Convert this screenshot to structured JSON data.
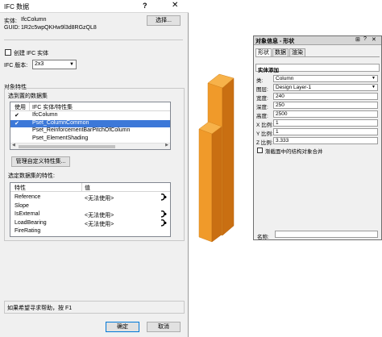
{
  "ifc_dialog": {
    "title": "IFC 数据",
    "help_glyph": "?",
    "close_glyph": "✕",
    "entity_label": "实体:",
    "entity_value": "IfcColumn",
    "guid_label": "GUID:",
    "guid_value": "1R2c5wpQKHw9l3d8RGzQL8",
    "select_button": "选择...",
    "create_checkbox_label": "创建 IFC 实体",
    "create_checked": false,
    "version_label": "IFC 版本:",
    "version_value": "2x3",
    "object_props": {
      "title": "对象特性",
      "psets_label": "选到置的数据集",
      "psets_header": {
        "use": "使用",
        "name": "IFC 实体/特性集"
      },
      "psets": [
        {
          "checked": true,
          "name": "IfcColumn",
          "selected": false
        },
        {
          "checked": true,
          "name": "Pset_ColumnCommon",
          "selected": true
        },
        {
          "checked": false,
          "name": "Pset_ReinforcementBarPitchOfColumn",
          "selected": false
        },
        {
          "checked": false,
          "name": "Pset_ElementShading",
          "selected": false
        }
      ],
      "manage_button": "管理自定义特性集...",
      "selected_psets_label": "选定数据集的特性:",
      "props_header": {
        "property": "特性",
        "value": "值"
      },
      "properties": [
        {
          "name": "Reference",
          "value": "<无法使用>",
          "icon": "mapping-icon"
        },
        {
          "name": "Slope",
          "value": "",
          "icon": ""
        },
        {
          "name": "IsExternal",
          "value": "<无法使用>",
          "icon": "mapping-icon"
        },
        {
          "name": "LoadBearing",
          "value": "<无法使用>",
          "icon": "mapping-icon"
        },
        {
          "name": "FireRating",
          "value": "",
          "icon": ""
        }
      ]
    },
    "help_hint": "如果希望寻求帮助，按 F1",
    "ok_button": "确定",
    "cancel_button": "取消"
  },
  "viewport": {
    "object_color": "#f09a2a",
    "object_color_dark": "#c96f12",
    "object_color_light": "#f7b24a"
  },
  "object_info": {
    "title": "对象信息 - 形状",
    "tabs": [
      {
        "label": "形状",
        "active": true
      },
      {
        "label": "数据",
        "active": false
      },
      {
        "label": "渲染",
        "active": false
      }
    ],
    "object_type": "实体添加",
    "fields": [
      {
        "label": "类:",
        "value": "Column",
        "dropdown": true
      },
      {
        "label": "图层:",
        "value": "Design Layer-1",
        "dropdown": true
      },
      {
        "label": "宽度:",
        "value": "240",
        "dropdown": false
      },
      {
        "label": "深度:",
        "value": "250",
        "dropdown": false
      },
      {
        "label": "高度:",
        "value": "2500",
        "dropdown": false
      },
      {
        "label": "X 比例:",
        "value": "1",
        "dropdown": false
      },
      {
        "label": "Y 比例:",
        "value": "1",
        "dropdown": false
      },
      {
        "label": "Z 比例:",
        "value": "3.333",
        "dropdown": false
      }
    ],
    "merge_checkbox_label": "渐截面中的结构对象合并",
    "merge_checked": false,
    "name_label": "名称:",
    "name_value": ""
  }
}
